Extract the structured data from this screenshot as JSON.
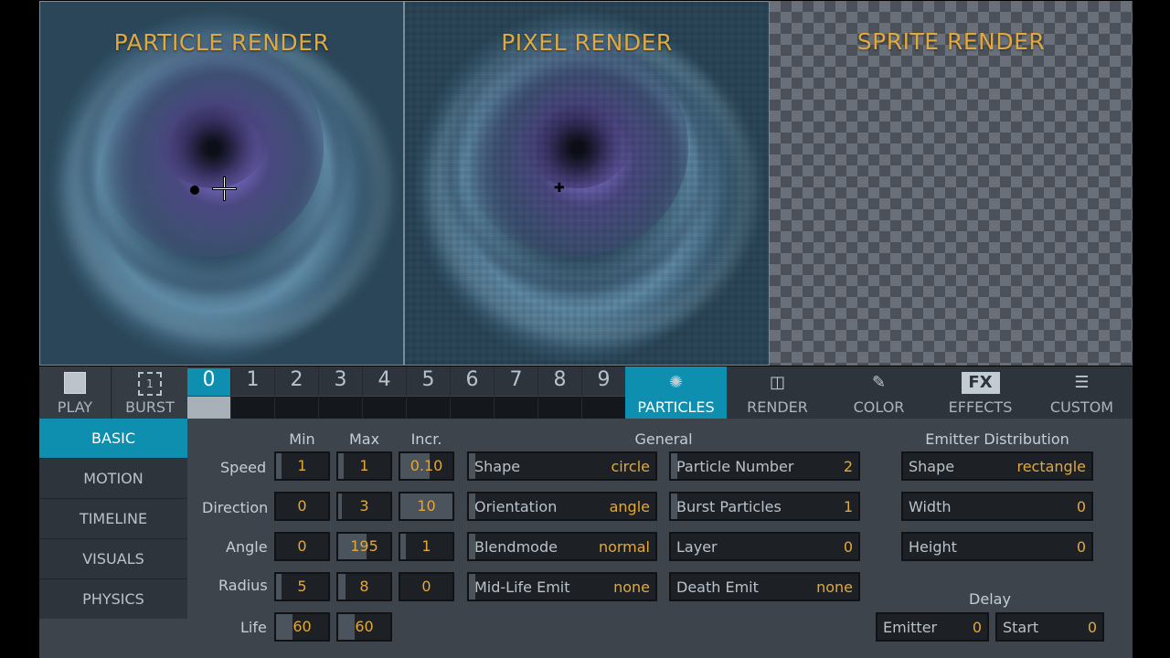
{
  "panels": {
    "particle_title": "PARTICLE RENDER",
    "pixel_title": "PIXEL RENDER",
    "sprite_title": "SPRITE RENDER"
  },
  "toolbar": {
    "play_label": "PLAY",
    "burst_label": "BURST",
    "burst_icon_text": "1",
    "slots": [
      "0",
      "1",
      "2",
      "3",
      "4",
      "5",
      "6",
      "7",
      "8",
      "9"
    ],
    "active_slot": "0",
    "tabs": [
      {
        "label": "PARTICLES",
        "icon": "particles-icon",
        "active": true
      },
      {
        "label": "RENDER",
        "icon": "render-icon",
        "active": false
      },
      {
        "label": "COLOR",
        "icon": "color-icon",
        "active": false
      },
      {
        "label": "EFFECTS",
        "icon": "fx-icon",
        "active": false
      },
      {
        "label": "CUSTOM",
        "icon": "custom-icon",
        "active": false
      }
    ],
    "fx_icon_text": "FX"
  },
  "sidebar": {
    "items": [
      "BASIC",
      "MOTION",
      "TIMELINE",
      "VISUALS",
      "PHYSICS"
    ],
    "active": "BASIC"
  },
  "basic": {
    "col_min": "Min",
    "col_max": "Max",
    "col_incr": "Incr.",
    "rows": [
      {
        "label": "Speed",
        "min": "1",
        "max": "1",
        "incr": "0.10"
      },
      {
        "label": "Direction",
        "min": "0",
        "max": "3",
        "incr": "10"
      },
      {
        "label": "Angle",
        "min": "0",
        "max": "195",
        "incr": "1"
      },
      {
        "label": "Radius",
        "min": "5",
        "max": "8",
        "incr": "0"
      },
      {
        "label": "Life",
        "min": "60",
        "max": "60"
      }
    ]
  },
  "general": {
    "title": "General",
    "left": [
      {
        "key": "Shape",
        "value": "circle"
      },
      {
        "key": "Orientation",
        "value": "angle"
      },
      {
        "key": "Blendmode",
        "value": "normal"
      },
      {
        "key": "Mid-Life Emit",
        "value": "none"
      }
    ],
    "right": [
      {
        "key": "Particle Number",
        "value": "2"
      },
      {
        "key": "Burst Particles",
        "value": "1"
      },
      {
        "key": "Layer",
        "value": "0"
      },
      {
        "key": "Death Emit",
        "value": "none"
      }
    ]
  },
  "emitter": {
    "title": "Emitter Distribution",
    "fields": [
      {
        "key": "Shape",
        "value": "rectangle"
      },
      {
        "key": "Width",
        "value": "0"
      },
      {
        "key": "Height",
        "value": "0"
      }
    ]
  },
  "delay": {
    "title": "Delay",
    "emitter_key": "Emitter",
    "emitter_value": "0",
    "start_key": "Start",
    "start_value": "0"
  },
  "colors": {
    "accent": "#0f8fb0",
    "value_text": "#e4a837",
    "title_text": "#e0a940"
  }
}
